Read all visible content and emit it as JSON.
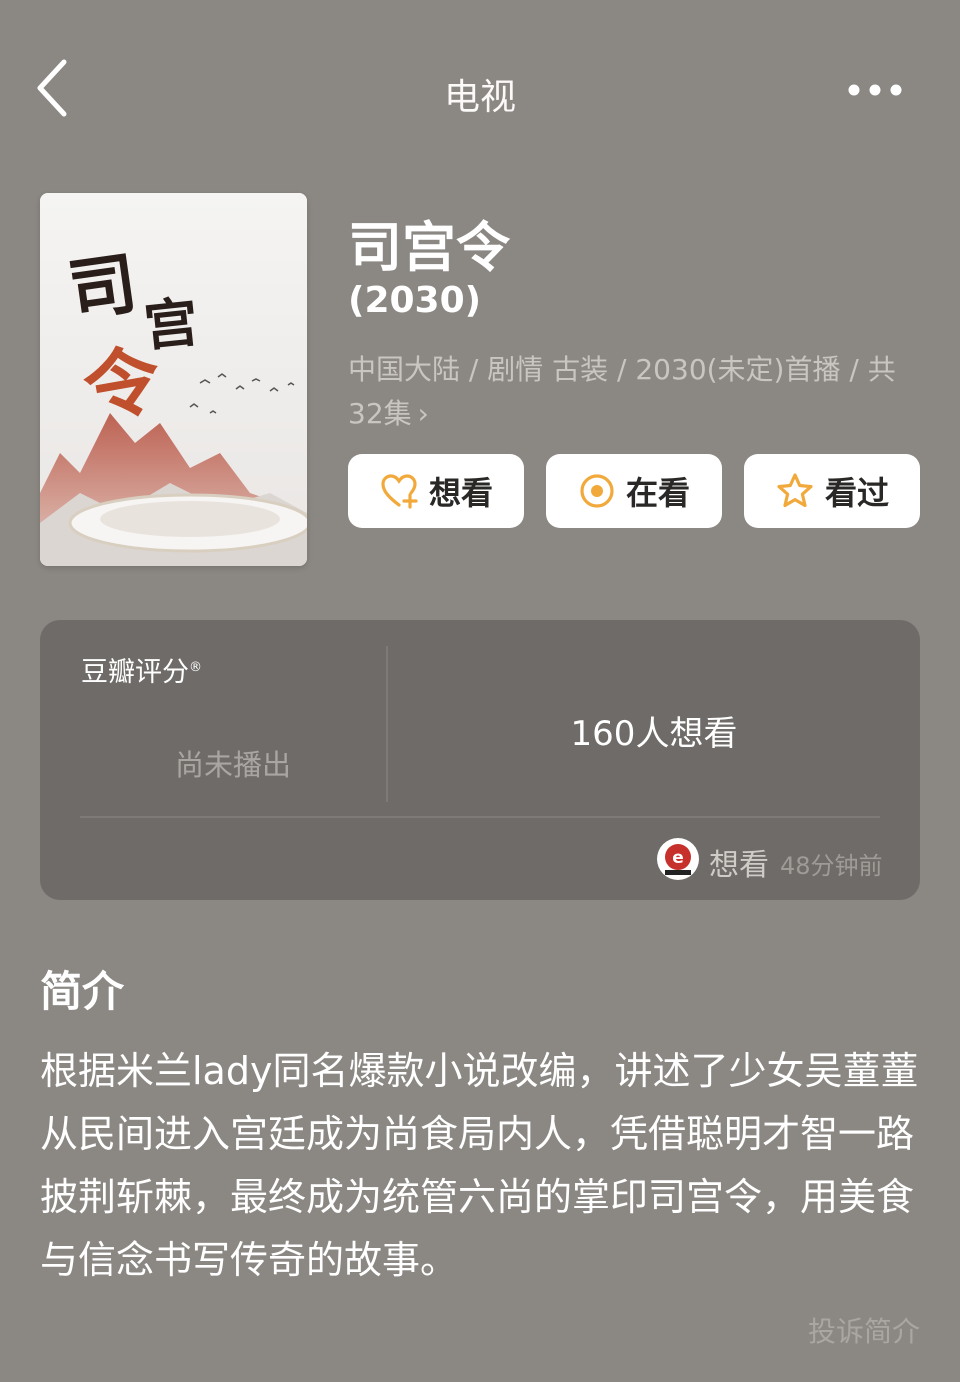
{
  "nav": {
    "title": "电视",
    "back_icon": "chevron-left-icon",
    "more_icon": "more-dots-icon"
  },
  "poster": {
    "calligraphy": "司宫令"
  },
  "show": {
    "title": "司宫令",
    "year": "(2030)",
    "meta": "中国大陆 / 剧情 古装 / 2030(未定)首播 / 共32集",
    "meta_chevron": "›"
  },
  "actions": [
    {
      "label": "想看",
      "icon": "heart-plus-icon"
    },
    {
      "label": "在看",
      "icon": "target-circle-icon"
    },
    {
      "label": "看过",
      "icon": "star-icon"
    }
  ],
  "rating": {
    "label": "豆瓣评分",
    "label_mark": "®",
    "status": "尚未播出",
    "want_count": "160人想看",
    "recent_action": "想看",
    "recent_time": "48分钟前"
  },
  "intro": {
    "heading": "简介",
    "body": "根据米兰lady同名爆款小说改编，讲述了少女吴蕫蕫从民间进入宫廷成为尚食局内人，凭借聪明才智一路披荆斩棘，最终成为统管六尚的掌印司宫令，用美食与信念书写传奇的故事。",
    "complain": "投诉简介"
  },
  "colors": {
    "accent": "#f2a93b",
    "background": "#8b8783",
    "card": "#6e6b68"
  }
}
